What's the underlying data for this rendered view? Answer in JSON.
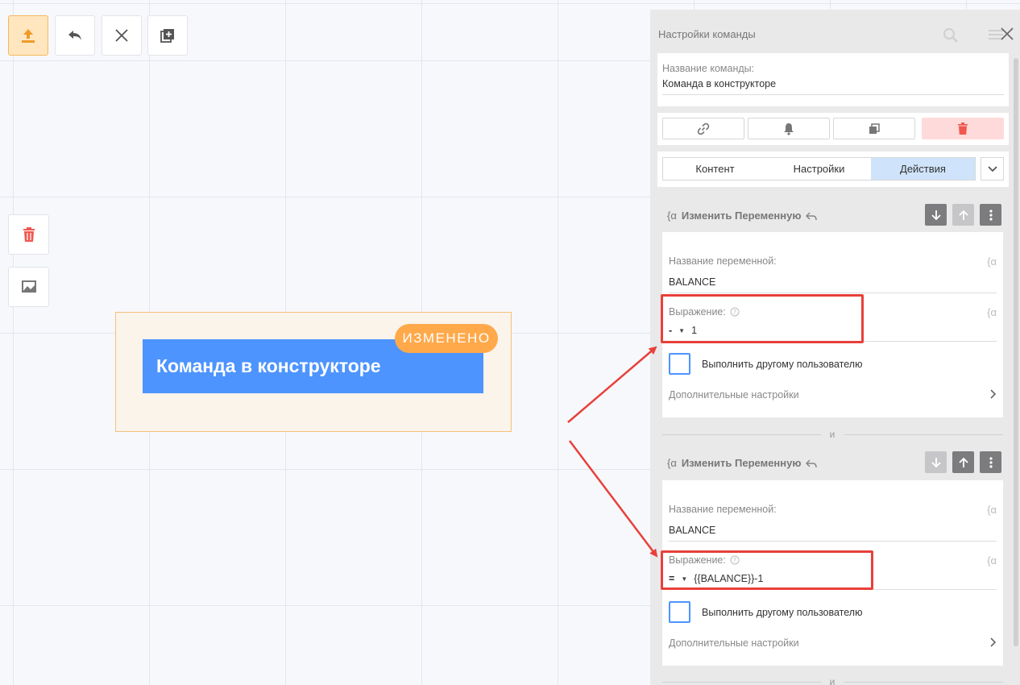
{
  "canvas": {
    "node_label": "Команда в конструкторе",
    "badge": "ИЗМЕНЕНО"
  },
  "toolbar": {
    "publish": "upload-icon",
    "undo": "undo-icon",
    "close": "close-icon",
    "duplicate": "add-copy-icon"
  },
  "sidebar_tools": [
    "trash-icon",
    "screen-icon"
  ],
  "panel": {
    "title": "Настройки команды",
    "command_name_label": "Название команды:",
    "command_name_value": "Команда в конструкторе",
    "tabs": [
      {
        "label": "Контент",
        "active": false
      },
      {
        "label": "Настройки",
        "active": false
      },
      {
        "label": "Действия",
        "active": true
      }
    ],
    "actions": [
      {
        "title": "Изменить Переменную",
        "var_label": "Название переменной:",
        "var_value": "BALANCE",
        "expr_label": "Выражение:",
        "operator": "-",
        "expr_value": "1",
        "checkbox_label": "Выполнить другому пользователю",
        "more": "Дополнительные настройки"
      },
      {
        "title": "Изменить Переменную",
        "var_label": "Название переменной:",
        "var_value": "BALANCE",
        "expr_label": "Выражение:",
        "operator": "=",
        "expr_value": "{{BALANCE}}-1",
        "checkbox_label": "Выполнить другому пользователю",
        "more": "Дополнительные настройки"
      }
    ],
    "joiner": "и"
  },
  "colors": {
    "accent": "#4d94ff",
    "badge": "#ffa94a",
    "highlight": "#e8403a",
    "danger": "#f0574f"
  }
}
